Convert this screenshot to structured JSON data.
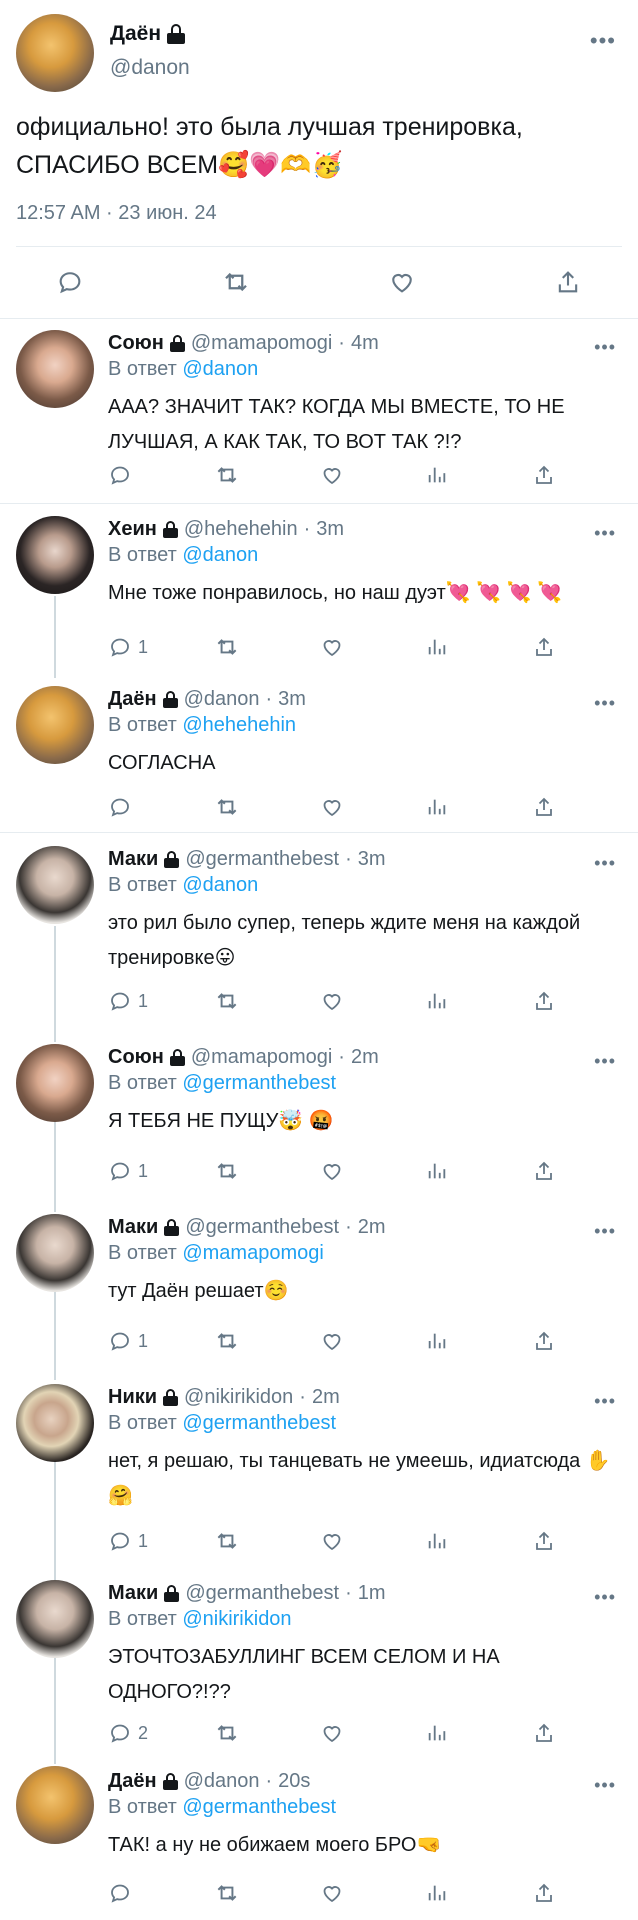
{
  "main_tweet": {
    "name": "Даён",
    "handle": "@danon",
    "text": "официально! это была лучшая тренировка, СПАСИБО ВСЕМ🥰💗🫶🥳",
    "timestamp": "12:57 AM · 23 июн. 24",
    "actions": [
      "reply-icon",
      "retweet-icon",
      "like-icon",
      "share-icon"
    ]
  },
  "more_label": "•••",
  "replies": [
    {
      "name": "Союн",
      "handle": "@mamapomogi",
      "time": "4m",
      "reply_label": "В ответ",
      "reply_to": "@danon",
      "text": "ААА? ЗНАЧИТ ТАК? КОГДА МЫ ВМЕСТЕ, ТО НЕ ЛУЧШАЯ, А КАК ТАК, ТО ВОТ ТАК ?!?",
      "reply_count": ""
    },
    {
      "name": "Хеин",
      "handle": "@hehehehin",
      "time": "3m",
      "reply_label": "В ответ",
      "reply_to": "@danon",
      "text": "Мне тоже понравилось, но наш дуэт💘 💘 💘 💘",
      "reply_count": "1"
    },
    {
      "name": "Даён",
      "handle": "@danon",
      "time": "3m",
      "reply_label": "В ответ",
      "reply_to": "@hehehehin",
      "text": "СОГЛАСНА",
      "reply_count": ""
    },
    {
      "name": "Маки",
      "handle": "@germanthebest",
      "time": "3m",
      "reply_label": "В ответ",
      "reply_to": "@danon",
      "text": "это рил было супер, теперь ждите меня на каждой тренировке😛",
      "reply_count": "1"
    },
    {
      "name": "Союн",
      "handle": "@mamapomogi",
      "time": "2m",
      "reply_label": "В ответ",
      "reply_to": "@germanthebest",
      "text": "Я ТЕБЯ НЕ ПУЩУ🤯 🤬",
      "reply_count": "1"
    },
    {
      "name": "Маки",
      "handle": "@germanthebest",
      "time": "2m",
      "reply_label": "В ответ",
      "reply_to": "@mamapomogi",
      "text": "тут Даён решает☺️",
      "reply_count": "1"
    },
    {
      "name": "Ники",
      "handle": "@nikirikidon",
      "time": "2m",
      "reply_label": "В ответ",
      "reply_to": "@germanthebest",
      "text": "нет, я решаю, ты танцевать не умеешь, идиатсюда ✋ 🤗",
      "reply_count": "1"
    },
    {
      "name": "Маки",
      "handle": "@germanthebest",
      "time": "1m",
      "reply_label": "В ответ",
      "reply_to": "@nikirikidon",
      "text": "ЭТОЧТОЗАБУЛЛИНГ ВСЕМ СЕЛОМ И НА ОДНОГО?!??",
      "reply_count": "2"
    },
    {
      "name": "Даён",
      "handle": "@danon",
      "time": "20s",
      "reply_label": "В ответ",
      "reply_to": "@germanthebest",
      "text": "ТАК! а ну не обижаем моего БРО🤜",
      "reply_count": ""
    }
  ],
  "colors": {
    "link": "#1da1f2",
    "muted": "#657786",
    "text": "#14171a",
    "separator": "#e6ecf0"
  }
}
